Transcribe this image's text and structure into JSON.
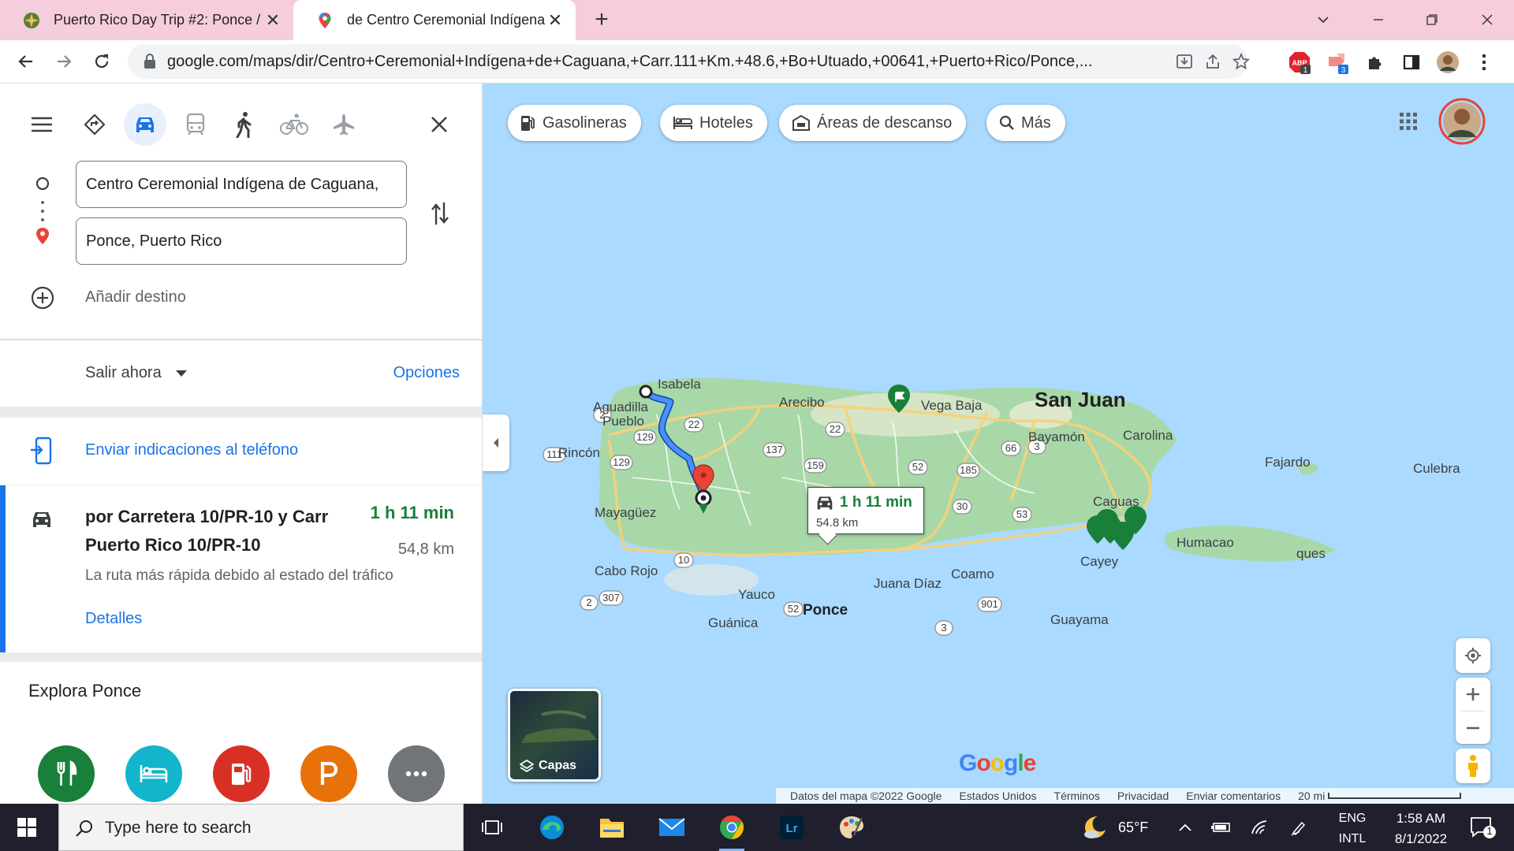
{
  "browser": {
    "tabs": [
      {
        "title": "Puerto Rico Day Trip #2: Ponce / ",
        "active": false
      },
      {
        "title": "de Centro Ceremonial Indígena d",
        "active": true
      }
    ],
    "url": "google.com/maps/dir/Centro+Ceremonial+Indígena+de+Caguana,+Carr.111+Km.+48.6,+Bo+Utuado,+00641,+Puerto+Rico/Ponce,...",
    "extension_badges": {
      "abp": "1",
      "second": "3"
    }
  },
  "directions": {
    "origin_value": "Centro Ceremonial Indígena de Caguana,",
    "destination_value": "Ponce, Puerto Rico",
    "add_destination": "Añadir destino",
    "depart_label": "Salir ahora",
    "options_label": "Opciones",
    "send_to_phone": "Enviar indicaciones al teléfono",
    "route": {
      "name": "por Carretera 10/PR-10 y Carr Puerto Rico 10/PR-10",
      "time": "1 h 11 min",
      "distance": "54,8 km",
      "description": "La ruta más rápida debido al estado del tráfico",
      "details_label": "Detalles"
    },
    "explore_title": "Explora Ponce"
  },
  "map": {
    "chips": [
      "Gasolineras",
      "Hoteles",
      "Áreas de descanso",
      "Más"
    ],
    "bubble_time": "1 h 11 min",
    "bubble_distance": "54.8 km",
    "layers_label": "Capas",
    "google_logo": "Google",
    "attribution": [
      "Datos del mapa ©2022 Google",
      "Estados Unidos",
      "Términos",
      "Privacidad",
      "Enviar comentarios",
      "20 mi"
    ],
    "places": {
      "isabela": "Isabela",
      "aguadilla1": "Aguadilla",
      "aguadilla2": "Pueblo",
      "arecibo": "Arecibo",
      "vega_baja": "Vega Baja",
      "san_juan": "San Juan",
      "bayamon": "Bayamón",
      "carolina": "Carolina",
      "fajardo": "Fajardo",
      "culebra": "Culebra",
      "rincon": "Rincón",
      "mayaguez": "Mayagüez",
      "caguas": "Caguas",
      "humacao": "Humacao",
      "vieques": "ques",
      "cayey": "Cayey",
      "cabo_rojo": "Cabo Rojo",
      "yauco": "Yauco",
      "ponce": "Ponce",
      "juana_diaz": "Juana Díaz",
      "coamo": "Coamo",
      "guanica": "Guánica",
      "guayama": "Guayama"
    },
    "shields": [
      "2",
      "22",
      "129",
      "22",
      "111",
      "129",
      "137",
      "159",
      "66",
      "3",
      "52",
      "185",
      "30",
      "53",
      "10",
      "307",
      "2",
      "52",
      "901",
      "3"
    ]
  },
  "taskbar": {
    "search_placeholder": "Type here to search",
    "weather": "65°F",
    "lang1": "ENG",
    "lang2": "INTL",
    "time": "1:58 AM",
    "date": "8/1/2022",
    "notifications": "1"
  },
  "colors": {
    "route_blue": "#1a73e8",
    "map_water": "#aadaff",
    "map_land": "#a8d8a8",
    "time_green": "#188038",
    "tab_strip": "#f5cddd"
  }
}
